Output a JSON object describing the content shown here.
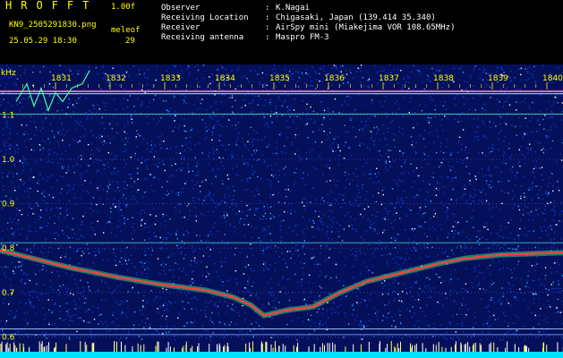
{
  "header": {
    "app_title": "HROFFT",
    "version": "1.00f",
    "file_name": "KN9_2505291830.png",
    "meleof": "meleof",
    "datetime": "25.05.29 18:30",
    "count": "29",
    "info": [
      {
        "key": "Observer",
        "value": "K.Nagai"
      },
      {
        "key": "Receiving Location",
        "value": "Chigasaki, Japan (139.414 35.340)"
      },
      {
        "key": "Receiver",
        "value": "AirSpy mini (Miakejima VOR 108.65MHz)"
      },
      {
        "key": "Receiving antenna",
        "value": "Maspro FM-3"
      }
    ]
  },
  "plot": {
    "y_unit": "kHz",
    "y_ticks": [
      "1.1",
      "1.0",
      "0.9",
      "0.8",
      "0.7",
      "0.6"
    ],
    "time_ticks": [
      "1831",
      "1832",
      "1833",
      "1834",
      "1835",
      "1836",
      "1837",
      "1838",
      "1839",
      "1840"
    ],
    "colors": {
      "background": "#05105a",
      "noise_dim": "#0a3bd0",
      "noise_bright": "#3fa0ff",
      "trace_core": "#ff4040",
      "trace_glow": "#40ff80",
      "carrier_line": "#9ad0ff",
      "cyan_bar": "#00e0ff",
      "axis_text": "#ffff00"
    }
  }
}
